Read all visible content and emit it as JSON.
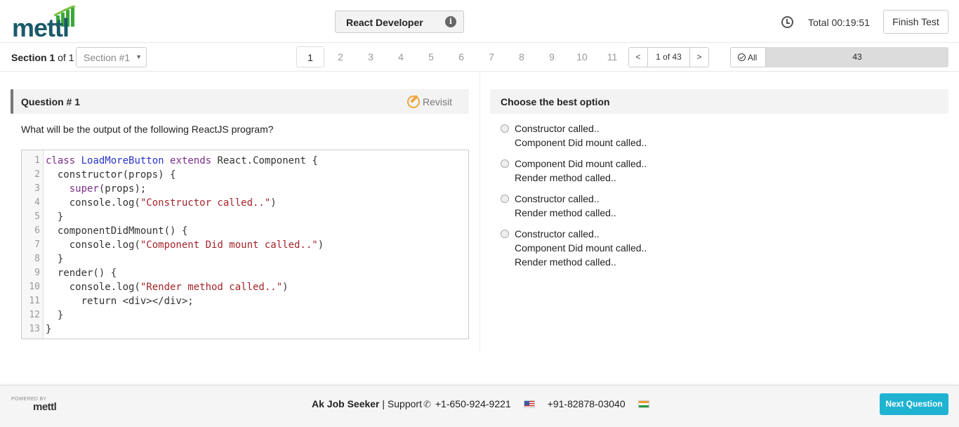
{
  "header": {
    "logo_text": "mettl",
    "test_title": "React Developer",
    "timer_label": "Total 00:19:51",
    "finish_label": "Finish Test"
  },
  "nav": {
    "section_bold": "Section 1",
    "section_of": " of 1",
    "section_select": "Section #1",
    "question_numbers": [
      "1",
      "2",
      "3",
      "4",
      "5",
      "6",
      "7",
      "8",
      "9",
      "10",
      "11"
    ],
    "active_question": "1",
    "pager_prev": "<",
    "pager_info": "1 of 43",
    "pager_next": ">",
    "filter_label": "All",
    "count": "43"
  },
  "question": {
    "title": "Question # 1",
    "revisit_label": "Revisit",
    "text": "What will be the output of the following ReactJS program?"
  },
  "code": {
    "line_numbers": [
      "1",
      "2",
      "3",
      "4",
      "5",
      "6",
      "7",
      "8",
      "9",
      "10",
      "11",
      "12",
      "13"
    ],
    "lines": [
      "class LoadMoreButton extends React.Component {",
      "  constructor(props) {",
      "    super(props);",
      "    console.log(\"Constructor called..\")",
      "  }",
      "  componentDidMmount() {",
      "    console.log(\"Component Did mount called..\")",
      "  }",
      "  render() {",
      "    console.log(\"Render method called..\")",
      "      return <div></div>;",
      "  }",
      "}"
    ]
  },
  "options": {
    "header": "Choose the best option",
    "items": [
      {
        "lines": [
          "Constructor called..",
          "Component Did mount called.."
        ]
      },
      {
        "lines": [
          "Component Did mount called..",
          "Render method called.."
        ]
      },
      {
        "lines": [
          "Constructor called..",
          "Render method called.."
        ]
      },
      {
        "lines": [
          "Constructor called..",
          "Component Did mount called..",
          "Render method called.."
        ]
      }
    ]
  },
  "footer": {
    "powered_by": "POWERED BY",
    "powered_logo": "mettl",
    "user_name": "Ak Job Seeker",
    "separator": " | ",
    "support_label": "Support",
    "phone_us": "+1-650-924-9221",
    "phone_in": "+91-82878-03040",
    "next_label": "Next Question"
  },
  "colors": {
    "brand": "#1a5a6a",
    "accent": "#1fb3d2",
    "revisit": "#f0a63c"
  }
}
